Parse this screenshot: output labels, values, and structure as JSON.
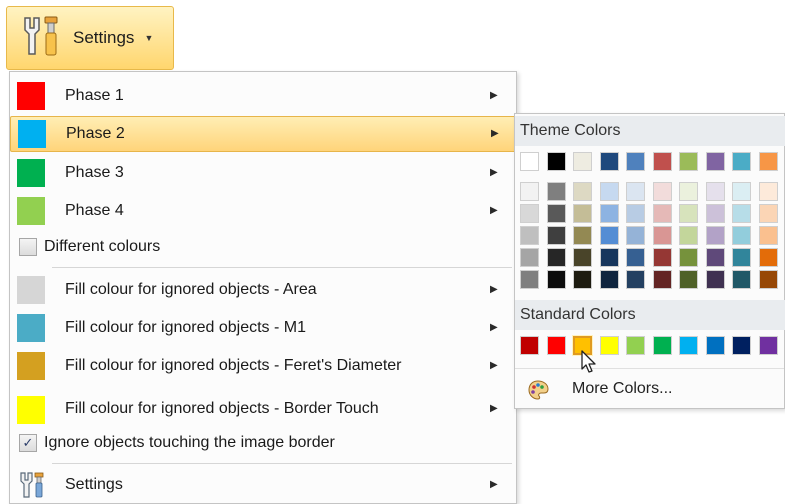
{
  "settings_button": {
    "label": "Settings",
    "icon": "settings-tools-icon",
    "caret": "chevron-down-icon"
  },
  "menu": {
    "phases": [
      {
        "label": "Phase 1",
        "color": "#ff0000",
        "highlighted": false
      },
      {
        "label": "Phase 2",
        "color": "#00b0f0",
        "highlighted": true
      },
      {
        "label": "Phase 3",
        "color": "#00b050",
        "highlighted": false
      },
      {
        "label": "Phase 4",
        "color": "#92d050",
        "highlighted": false
      }
    ],
    "different_colours": {
      "label": "Different colours",
      "checked": false
    },
    "fill_items": [
      {
        "label": "Fill colour for ignored objects - Area",
        "color": "#d6d6d6"
      },
      {
        "label": "Fill colour for ignored objects - M1",
        "color": "#4bacc6"
      },
      {
        "label": "Fill colour for ignored objects - Feret's Diameter",
        "color": "#d4a020"
      },
      {
        "label": "Fill colour for ignored objects - Border Touch",
        "color": "#ffff00"
      }
    ],
    "ignore_border": {
      "label": "Ignore objects touching the image border",
      "checked": true,
      "check_glyph": "✓"
    },
    "settings_item": {
      "label": "Settings",
      "icon": "settings-tools-icon"
    },
    "submenu_arrow": "▶"
  },
  "color_picker": {
    "theme_header": "Theme Colors",
    "theme_top": [
      "#ffffff",
      "#000000",
      "#eeece1",
      "#1f497d",
      "#4f81bd",
      "#c0504d",
      "#9bbb59",
      "#8064a2",
      "#4bacc6",
      "#f79646"
    ],
    "theme_shades": [
      [
        "#f2f2f2",
        "#d8d8d8",
        "#bfbfbf",
        "#a5a5a5",
        "#7f7f7f"
      ],
      [
        "#7f7f7f",
        "#595959",
        "#3f3f3f",
        "#262626",
        "#0c0c0c"
      ],
      [
        "#ddd9c3",
        "#c4bd97",
        "#938953",
        "#494429",
        "#1d1b10"
      ],
      [
        "#c6d9f0",
        "#8db3e2",
        "#548dd4",
        "#17365d",
        "#0f243e"
      ],
      [
        "#dbe5f1",
        "#b8cce4",
        "#95b3d7",
        "#366092",
        "#244061"
      ],
      [
        "#f2dcdb",
        "#e5b9b7",
        "#d99694",
        "#953734",
        "#632423"
      ],
      [
        "#ebf1dd",
        "#d7e3bc",
        "#c3d69b",
        "#76923c",
        "#4f6128"
      ],
      [
        "#e5e0ec",
        "#ccc1d9",
        "#b2a2c7",
        "#5f497a",
        "#3f3151"
      ],
      [
        "#dbeef3",
        "#b7dde8",
        "#92cddc",
        "#31859b",
        "#205867"
      ],
      [
        "#fdeada",
        "#fbd5b5",
        "#fac08f",
        "#e36c09",
        "#974806"
      ]
    ],
    "standard_header": "Standard Colors",
    "standard": [
      "#c00000",
      "#ff0000",
      "#ffc000",
      "#ffff00",
      "#92d050",
      "#00b050",
      "#00b0f0",
      "#0070c0",
      "#002060",
      "#7030a0"
    ],
    "standard_selected_index": 2,
    "more_colors": {
      "label": "More Colors...",
      "icon": "palette-icon"
    }
  }
}
